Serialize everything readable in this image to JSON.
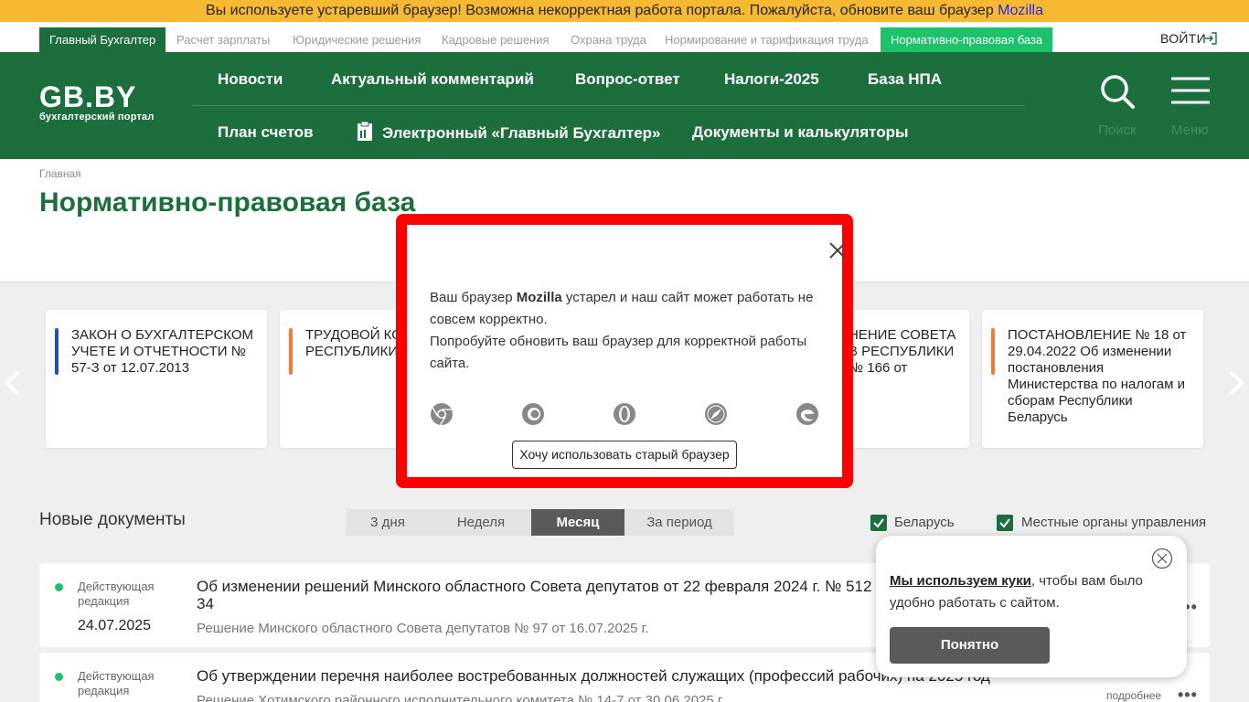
{
  "warning": {
    "text": "Вы используете устаревший браузер! Возможна некорректная работа портала. Пожалуйста, обновите ваш браузер",
    "browser": "Mozilla"
  },
  "portals": [
    "Главный Бухгалтер",
    "Расчет зарплаты",
    "Юридические решения",
    "Кадровые решения",
    "Охрана труда",
    "Нормирование и тарификация труда",
    "Нормативно-правовая база"
  ],
  "login": "ВОЙТИ",
  "logo": {
    "main": "GB.BY",
    "sub": "бухгалтерский портал"
  },
  "nav": [
    "Новости",
    "Актуальный комментарий",
    "Вопрос-ответ",
    "Налоги-2025",
    "База НПА",
    "План счетов",
    "Электронный «Главный Бухгалтер»",
    "Документы и калькуляторы"
  ],
  "header_labels": {
    "search": "Поиск",
    "menu": "Меню"
  },
  "breadcrumb": "Главная",
  "page_title": "Нормативно-правовая база",
  "cards": [
    {
      "text": "ЗАКОН О БУХГАЛТЕРСКОМ УЧЕТЕ И ОТЧЕТНОСТИ № 57-З от 12.07.2013",
      "accent": "#1f4fbf"
    },
    {
      "text": "ТРУДОВОЙ КО РЕСПУБЛИКИ",
      "accent": "#f07a3a"
    },
    {
      "text": "НЕНИЕ СОВЕТА В РЕСПУБЛИКИ № 166 от",
      "accent": "#f07a3a"
    },
    {
      "text": "ПОСТАНОВЛЕНИЕ № 18 от 29.04.2022 Об изменении постановления Министерства по налогам и сборам Республики Беларусь",
      "accent": "#f07a3a"
    }
  ],
  "new_docs": {
    "title": "Новые документы",
    "periods": [
      "3 дня",
      "Неделя",
      "Месяц",
      "За период"
    ],
    "active_period": "Месяц",
    "filters": [
      "Беларусь",
      "Местные органы управления"
    ]
  },
  "documents": [
    {
      "status": "Действующая редакция",
      "date": "24.07.2025",
      "title": "Об изменении решений Минского областного Совета депутатов от 22 февраля 2024 г. № 512 34",
      "subtitle": "Решение Минского областного Совета депутатов № 97 от 16.07.2025 г."
    },
    {
      "status": "Действующая редакция",
      "date": "",
      "title": "Об утверждении перечня наиболее востребованных должностей служащих (профессий рабочих) на 2025 год",
      "subtitle": "Решение Хотимского районного исполнительного комитета № 14-7 от 30.06.2025 г.",
      "more": "подробнее"
    }
  ],
  "modal": {
    "line1_pre": "Ваш браузер",
    "browser": "Mozilla",
    "line1_post": "устарел и наш сайт может работать не совсем корректно.",
    "line2": "Попробуйте обновить ваш браузер для корректной работы сайта.",
    "browsers": [
      "chrome-icon",
      "firefox-icon",
      "opera-icon",
      "safari-icon",
      "edge-icon"
    ],
    "button": "Хочу использовать старый браузер"
  },
  "cookie": {
    "link": "Мы используем куки",
    "text": ", чтобы вам было удобно работать с сайтом.",
    "button": "Понятно"
  }
}
